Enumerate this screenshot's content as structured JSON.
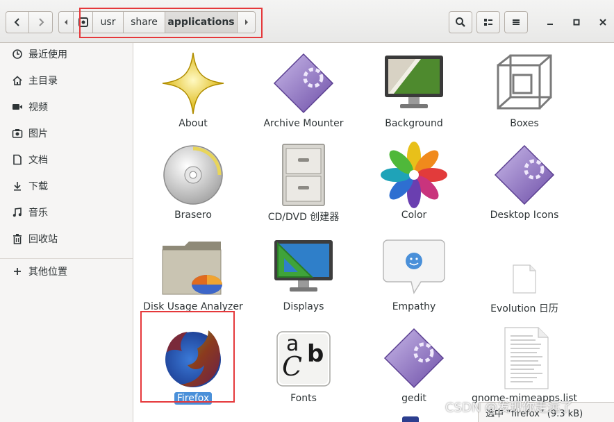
{
  "header": {
    "breadcrumbs": [
      "usr",
      "share",
      "applications"
    ],
    "active_crumb": "applications"
  },
  "sidebar": {
    "items": [
      {
        "label": "最近使用",
        "icon": "clock-icon"
      },
      {
        "label": "主目录",
        "icon": "home-icon"
      },
      {
        "label": "视频",
        "icon": "video-icon"
      },
      {
        "label": "图片",
        "icon": "camera-icon"
      },
      {
        "label": "文档",
        "icon": "document-icon"
      },
      {
        "label": "下载",
        "icon": "download-icon"
      },
      {
        "label": "音乐",
        "icon": "music-icon"
      },
      {
        "label": "回收站",
        "icon": "trash-icon"
      },
      {
        "label": "其他位置",
        "icon": "plus-icon"
      }
    ]
  },
  "files": [
    {
      "name": "About"
    },
    {
      "name": "Archive Mounter"
    },
    {
      "name": "Background"
    },
    {
      "name": "Boxes"
    },
    {
      "name": "Brasero"
    },
    {
      "name": "CD/DVD 创建器"
    },
    {
      "name": "Color"
    },
    {
      "name": "Desktop Icons"
    },
    {
      "name": "Disk Usage Analyzer"
    },
    {
      "name": "Displays"
    },
    {
      "name": "Empathy"
    },
    {
      "name": "Evolution 日历"
    },
    {
      "name": "Firefox",
      "selected": true
    },
    {
      "name": "Fonts"
    },
    {
      "name": "gedit"
    },
    {
      "name": "gnome-mimeapps.list"
    }
  ],
  "status": {
    "text": "选中 “firefox” (9.3 kB)"
  },
  "watermark": {
    "text": "CSDN @发现你走远了"
  },
  "colors": {
    "selection": "#4a90d9",
    "highlight_box": "#e5383b"
  }
}
